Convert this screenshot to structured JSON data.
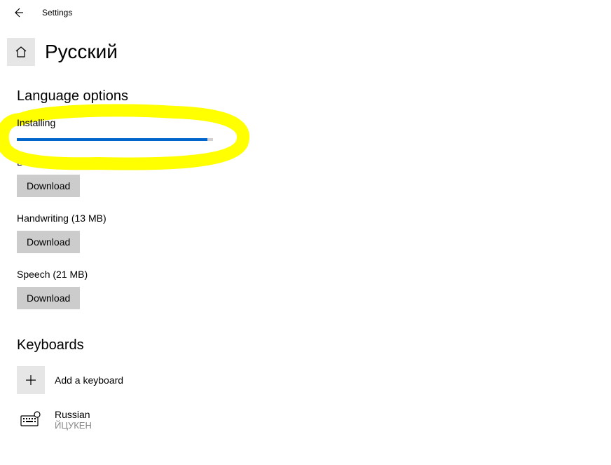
{
  "topbar": {
    "title": "Settings"
  },
  "header": {
    "language_title": "Русский"
  },
  "sections": {
    "language_options": "Language options",
    "keyboards": "Keyboards"
  },
  "install": {
    "status": "Installing",
    "progress_percent": 97
  },
  "features": {
    "basic_typing": {
      "label": "Basic typing (9 MB)",
      "button": "Download"
    },
    "handwriting": {
      "label": "Handwriting (13 MB)",
      "button": "Download"
    },
    "speech": {
      "label": "Speech (21 MB)",
      "button": "Download"
    }
  },
  "keyboards": {
    "add_label": "Add a keyboard",
    "items": [
      {
        "name": "Russian",
        "layout": "ЙЦУКЕН"
      }
    ]
  }
}
